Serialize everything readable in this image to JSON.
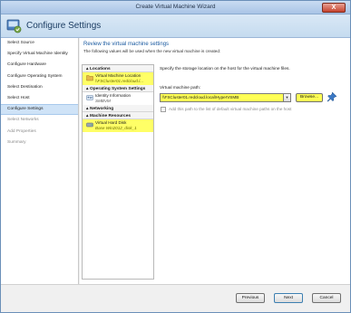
{
  "window": {
    "title": "Create Virtual Machine Wizard",
    "close_glyph": "X"
  },
  "header": {
    "title": "Configure Settings",
    "icon": "settings-wizard-icon"
  },
  "nav": {
    "items": [
      {
        "label": "Select Source",
        "state": "normal"
      },
      {
        "label": "Specify Virtual Machine Identity",
        "state": "normal"
      },
      {
        "label": "Configure Hardware",
        "state": "normal"
      },
      {
        "label": "Configure Operating System",
        "state": "normal"
      },
      {
        "label": "Select Destination",
        "state": "normal"
      },
      {
        "label": "Select Host",
        "state": "normal"
      },
      {
        "label": "Configure Settings",
        "state": "selected"
      },
      {
        "label": "Select Networks",
        "state": "disabled"
      },
      {
        "label": "Add Properties",
        "state": "disabled"
      },
      {
        "label": "Summary",
        "state": "disabled"
      }
    ]
  },
  "main": {
    "section_title": "Review the virtual machine settings",
    "section_subtitle": "The following values will be used when the new virtual machine is created:"
  },
  "tree": {
    "locations": {
      "label": "Locations",
      "item_title": "Virtual Machine Location",
      "item_value": "\\\\FSCluster01.redcloud.l..."
    },
    "os_settings": {
      "label": "Operating System Settings",
      "item_title": "Identity Information",
      "item_value": "SMBVM"
    },
    "networking": {
      "label": "Networking"
    },
    "machine_resources": {
      "label": "Machine Resources",
      "item_title": "Virtual Hard Disk",
      "item_value": "Base Win2012_disk_1"
    }
  },
  "panel": {
    "description": "Specify the storage location on the host for the virtual machine files.",
    "path_label": "Virtual machine path:",
    "path_value": "\\\\FSCluster01.redcloud.local\\HyperVSMB",
    "browse_label": "Browse...",
    "add_path_label": "Add this path to the list of default virtual machine paths on the host",
    "add_path_checked": false
  },
  "footer": {
    "previous": "Previous",
    "next": "Next",
    "cancel": "Cancel"
  },
  "colors": {
    "highlight": "#ffff55",
    "accent": "#1a5aa0",
    "selected_nav": "#cfe3f7"
  }
}
